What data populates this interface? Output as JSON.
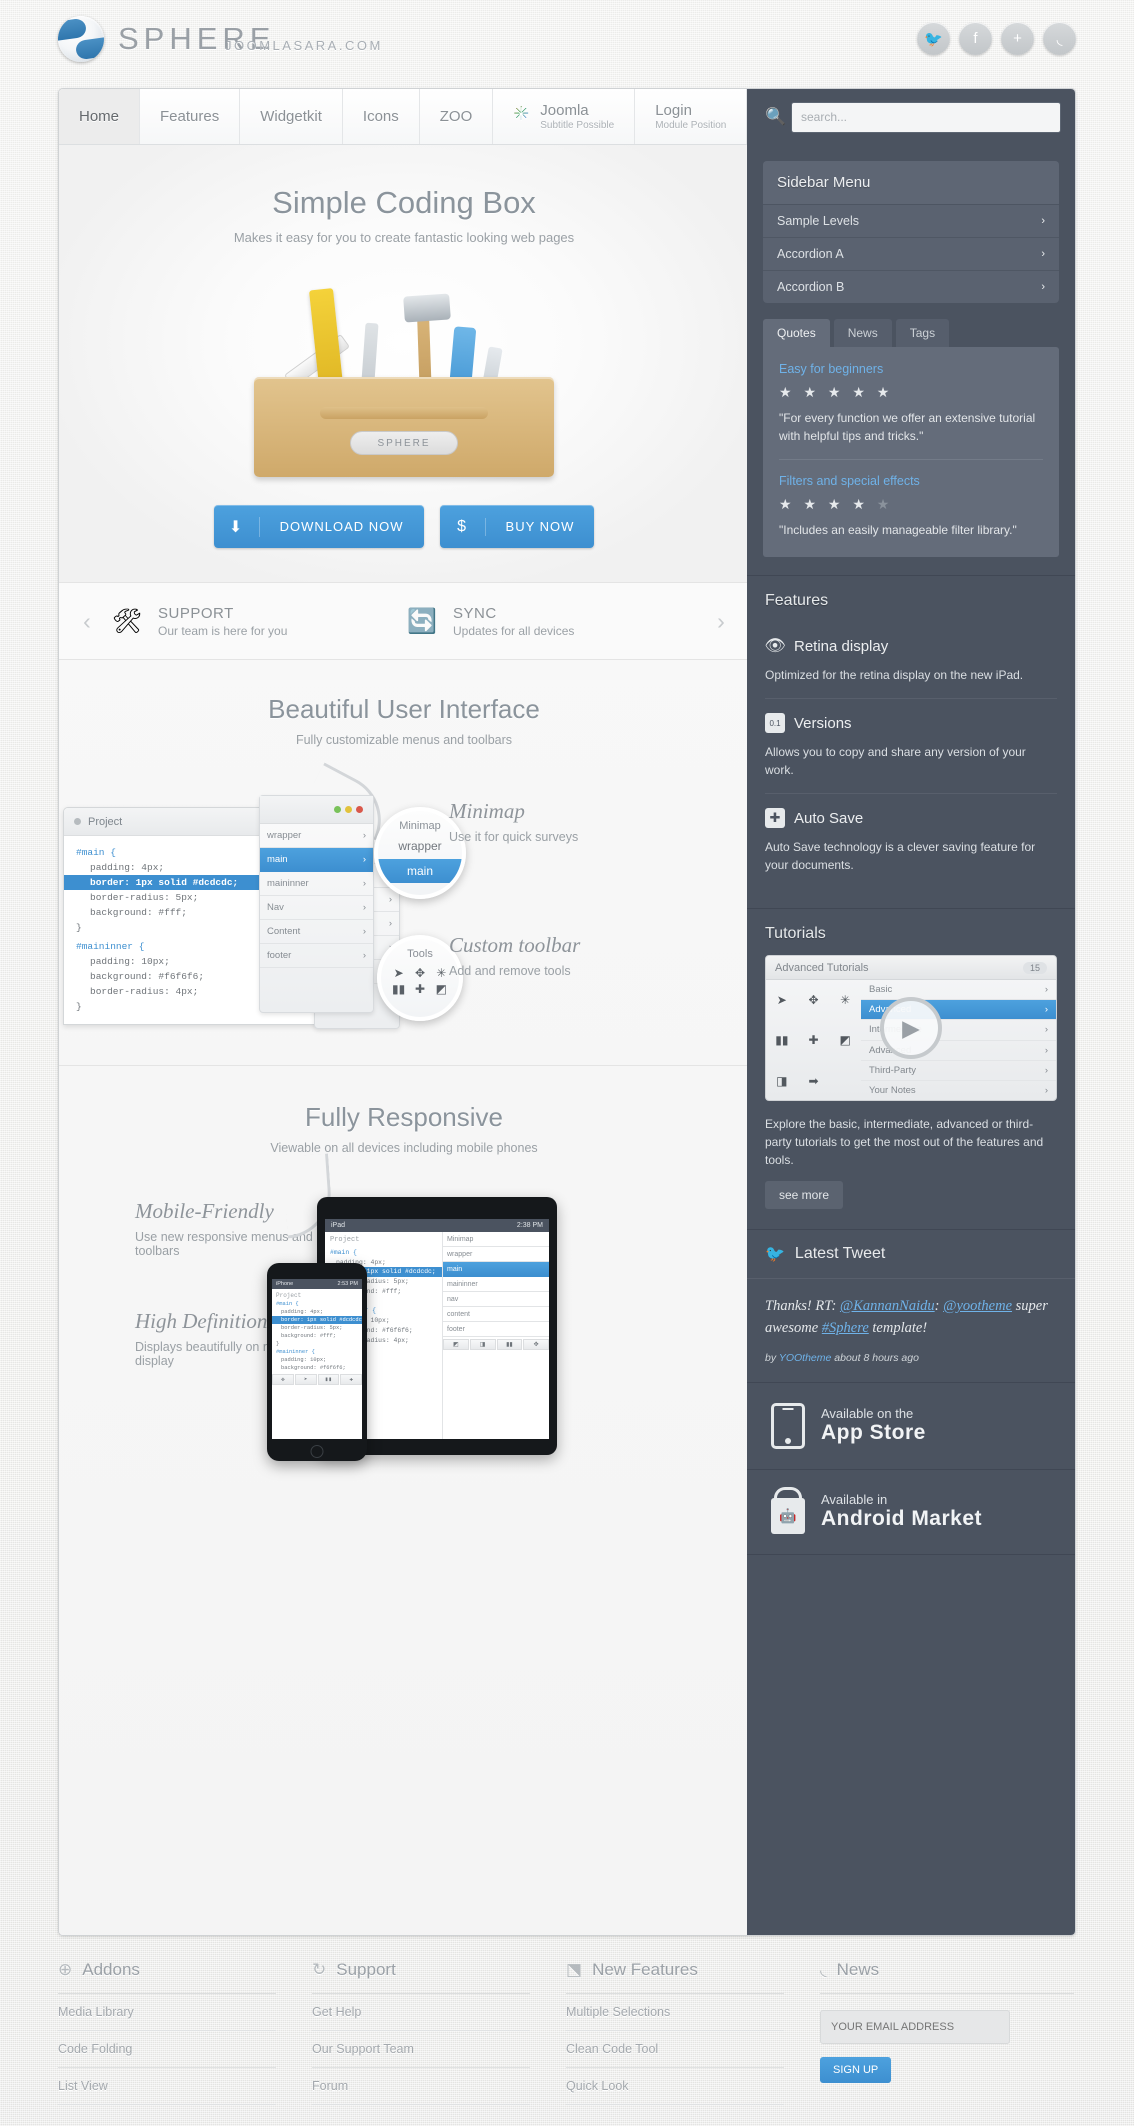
{
  "header": {
    "logo_text": "SPHERE",
    "tagline": "JOOMLASARA.COM",
    "social": [
      {
        "name": "twitter-icon",
        "glyph": "🐦"
      },
      {
        "name": "facebook-icon",
        "glyph": "f"
      },
      {
        "name": "google-plus-icon",
        "glyph": "+"
      },
      {
        "name": "rss-icon",
        "glyph": "◟"
      }
    ]
  },
  "nav": {
    "items": [
      {
        "label": "Home",
        "sub": "",
        "active": true,
        "icon": ""
      },
      {
        "label": "Features",
        "sub": "",
        "active": false,
        "icon": ""
      },
      {
        "label": "Widgetkit",
        "sub": "",
        "active": false,
        "icon": ""
      },
      {
        "label": "Icons",
        "sub": "",
        "active": false,
        "icon": ""
      },
      {
        "label": "ZOO",
        "sub": "",
        "active": false,
        "icon": ""
      },
      {
        "label": "Joomla",
        "sub": "Subtitle Possible",
        "active": false,
        "icon": "joomla-icon"
      },
      {
        "label": "Login",
        "sub": "Module Position",
        "active": false,
        "icon": ""
      }
    ]
  },
  "search": {
    "placeholder": "search...",
    "value": "",
    "icon": "search-icon"
  },
  "hero": {
    "title": "Simple Coding Box",
    "subtitle": "Makes it easy for you to create fantastic looking web pages",
    "toolbox_label": "SPHERE",
    "download_label": "DOWNLOAD NOW",
    "download_icon": "download-arrow-icon",
    "buy_label": "BUY NOW",
    "buy_icon": "dollar-icon"
  },
  "carousel": {
    "prev_icon": "chevron-left-icon",
    "next_icon": "chevron-right-icon",
    "items": [
      {
        "icon": "wrench-screwdriver-icon",
        "glyph": "🛠",
        "title": "SUPPORT",
        "subtitle": "Our team is here for you"
      },
      {
        "icon": "sync-arrows-icon",
        "glyph": "🔄",
        "title": "SYNC",
        "subtitle": "Updates for all devices"
      }
    ]
  },
  "ui_section": {
    "title": "Beautiful User Interface",
    "subtitle": "Fully customizable menus and toolbars",
    "editor": {
      "project_label": "Project",
      "code_lines": [
        {
          "text": "#main {",
          "kind": "kw"
        },
        {
          "text": "padding: 4px;",
          "kind": "indent"
        },
        {
          "text": "border: 1px solid #dcdcdc;",
          "kind": "sel"
        },
        {
          "text": "border-radius: 5px;",
          "kind": "indent"
        },
        {
          "text": "background: #fff;",
          "kind": "indent"
        },
        {
          "text": "}",
          "kind": "plain"
        },
        {
          "text": "",
          "kind": "plain"
        },
        {
          "text": "#maininner {",
          "kind": "kw"
        },
        {
          "text": "padding: 10px;",
          "kind": "indent"
        },
        {
          "text": "background: #f6f6f6;",
          "kind": "indent"
        },
        {
          "text": "border-radius: 4px;",
          "kind": "indent"
        },
        {
          "text": "}",
          "kind": "plain"
        }
      ],
      "pane_rows": [
        "wrapper",
        "main",
        "maininner",
        "Nav",
        "Content",
        "footer"
      ],
      "pane_active": "main"
    },
    "bubbles": {
      "minimap_title": "Minimap",
      "minimap_rows": [
        "wrapper",
        "main"
      ],
      "tools_title": "Tools",
      "tool_glyphs": [
        "➤",
        "✥",
        "✳",
        "▮▮",
        "✚",
        "◩"
      ]
    },
    "annotations": [
      {
        "title": "Minimap",
        "subtitle": "Use it for quick surveys"
      },
      {
        "title": "Custom toolbar",
        "subtitle": "Add and remove tools"
      }
    ]
  },
  "resp_section": {
    "title": "Fully Responsive",
    "subtitle": "Viewable on all devices including mobile phones",
    "features": [
      {
        "title": "Mobile-Friendly",
        "text": "Use new responsive menus and toolbars"
      },
      {
        "title": "High Definition",
        "text": "Displays beautifully on retina display"
      }
    ],
    "ipad": {
      "left_label": "iPad",
      "time": "2:38 PM",
      "project_label": "Project",
      "minimap_label": "Minimap",
      "code_lines": [
        "#main {",
        "padding: 4px;",
        "border: 1px solid #dcdcdc;",
        "border-radius: 5px;",
        "background: #fff;",
        "}",
        "#maininner {",
        "padding: 10px;",
        "background: #f6f6f6;",
        "border-radius: 4px;"
      ],
      "pane_rows": [
        "wrapper",
        "main",
        "maininner",
        "nav",
        "content",
        "footer"
      ],
      "pane_active": "main"
    },
    "iphone": {
      "left_label": "iPhone",
      "time": "2:53 PM",
      "project_label": "Project",
      "code_lines": [
        "#main {",
        "padding: 4px;",
        "border: 1px solid #dcdcdc;",
        "border-radius: 5px;",
        "background: #fff;",
        "}",
        "#maininner {",
        "padding: 10px;",
        "background: #f6f6f6;"
      ]
    }
  },
  "sidebar": {
    "menu": {
      "title": "Sidebar Menu",
      "items": [
        {
          "label": "Sample Levels",
          "chevron": "›"
        },
        {
          "label": "Accordion A",
          "chevron": "›"
        },
        {
          "label": "Accordion B",
          "chevron": "›"
        }
      ]
    },
    "tabs": [
      {
        "label": "Quotes",
        "active": true
      },
      {
        "label": "News",
        "active": false
      },
      {
        "label": "Tags",
        "active": false
      }
    ],
    "quotes": [
      {
        "title": "Easy for beginners",
        "rating": 5,
        "text": "\"For every function we offer an extensive tutorial with helpful tips and tricks.\""
      },
      {
        "title": "Filters and special effects",
        "rating": 4,
        "text": "\"Includes an easily manageable filter library.\""
      }
    ],
    "features": {
      "title": "Features",
      "items": [
        {
          "icon": "eye-icon",
          "glyph": "👁",
          "title": "Retina display",
          "text": "Optimized for the retina display on the new iPad."
        },
        {
          "icon": "versions-document-icon",
          "glyph": "0.1",
          "title": "Versions",
          "text": "Allows you to copy and share any version of your work."
        },
        {
          "icon": "auto-save-plus-icon",
          "glyph": "✚",
          "title": "Auto Save",
          "text": "Auto Save technology is a clever saving feature for your documents."
        }
      ]
    },
    "tutorials": {
      "title": "Tutorials",
      "panel_title": "Advanced Tutorials",
      "badge": "15",
      "rows": [
        "Basic",
        "Advanced",
        "Intermediate",
        "Advanced",
        "Third-Party",
        "Your Notes"
      ],
      "active_row": "Advanced",
      "tool_glyphs": [
        "➤",
        "✥",
        "✳",
        "▮▮",
        "✚",
        "◩",
        "◨",
        "➡"
      ],
      "play_icon": "play-icon",
      "text": "Explore the basic, intermediate, advanced or third-party tutorials to get the most out of the features and tools.",
      "button": "see more"
    },
    "tweet": {
      "icon": "twitter-bird-icon",
      "title": "Latest Tweet",
      "prefix": "Thanks! RT: ",
      "mention1": "@KannanNaidu",
      "mid": ": ",
      "mention2": "@yootheme",
      "body": " super awesome ",
      "hashtag": "#Sphere",
      "suffix": " template!",
      "meta_by": "by ",
      "meta_author": "YOOtheme",
      "meta_time": " about 8 hours ago"
    },
    "stores": [
      {
        "icon": "iphone-icon",
        "line1": "Available on the",
        "line2": "App Store"
      },
      {
        "icon": "android-bag-icon",
        "line1": "Available in",
        "line2": "Android Market"
      }
    ]
  },
  "footer": {
    "columns": [
      {
        "icon": "plus-circle-icon",
        "glyph": "⊕",
        "title": "Addons",
        "links": [
          "Media Library",
          "Code Folding",
          "List View"
        ]
      },
      {
        "icon": "refresh-icon",
        "glyph": "↻",
        "title": "Support",
        "links": [
          "Get Help",
          "Our Support Team",
          "Forum"
        ]
      },
      {
        "icon": "cube-icon",
        "glyph": "⬔",
        "title": "New Features",
        "links": [
          "Multiple Selections",
          "Clean Code Tool",
          "Quick Look"
        ]
      },
      {
        "icon": "rss-icon",
        "glyph": "◟",
        "title": "News",
        "links": []
      }
    ],
    "newsletter": {
      "placeholder": "YOUR EMAIL ADDRESS",
      "value": "",
      "button": "SIGN UP"
    }
  },
  "colors": {
    "accent": "#3d8fd0",
    "sidebar_bg": "#4b5360",
    "panel_bg": "#f4f4f4",
    "text_muted": "#9aa0a5"
  }
}
